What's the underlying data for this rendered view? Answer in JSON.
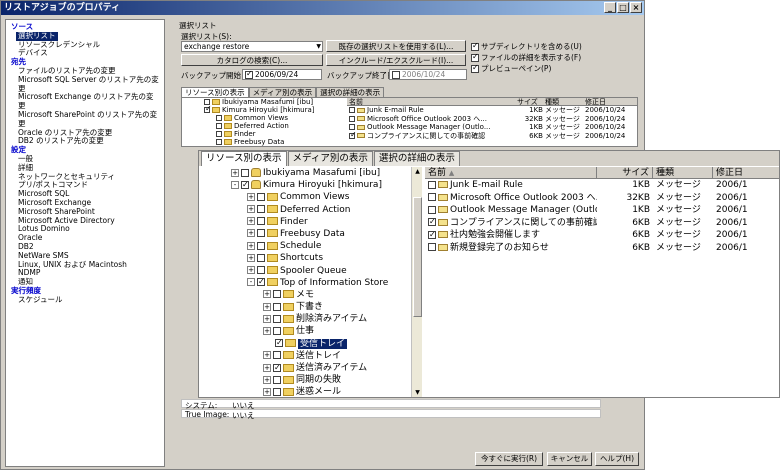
{
  "window": {
    "title": "リストアジョブのプロパティ",
    "controls": [
      "_",
      "□",
      "×"
    ]
  },
  "nav": [
    {
      "type": "sec",
      "label": "ソース"
    },
    {
      "type": "sel",
      "label": "選択リスト"
    },
    {
      "type": "it",
      "label": "リソースクレデンシャル"
    },
    {
      "type": "it",
      "label": "デバイス"
    },
    {
      "type": "sec",
      "label": "宛先"
    },
    {
      "type": "it",
      "label": "ファイルのリストア先の変更"
    },
    {
      "type": "it",
      "label": "Microsoft SQL Server のリストア先の変更"
    },
    {
      "type": "it",
      "label": "Microsoft Exchange のリストア先の変更"
    },
    {
      "type": "it",
      "label": "Microsoft SharePoint のリストア先の変更"
    },
    {
      "type": "it",
      "label": "Oracle のリストア先の変更"
    },
    {
      "type": "it",
      "label": "DB2 のリストア先の変更"
    },
    {
      "type": "sec",
      "label": "設定"
    },
    {
      "type": "it",
      "label": "一般"
    },
    {
      "type": "it",
      "label": "詳細"
    },
    {
      "type": "it",
      "label": "ネットワークとセキュリティ"
    },
    {
      "type": "it",
      "label": "プリ/ポストコマンド"
    },
    {
      "type": "it",
      "label": "Microsoft SQL"
    },
    {
      "type": "it",
      "label": "Microsoft Exchange"
    },
    {
      "type": "it",
      "label": "Microsoft SharePoint"
    },
    {
      "type": "it",
      "label": "Microsoft Active Directory"
    },
    {
      "type": "it",
      "label": "Lotus Domino"
    },
    {
      "type": "it",
      "label": "Oracle"
    },
    {
      "type": "it",
      "label": "DB2"
    },
    {
      "type": "it",
      "label": "NetWare SMS"
    },
    {
      "type": "it",
      "label": "Linux, UNIX および Macintosh"
    },
    {
      "type": "it",
      "label": "NDMP"
    },
    {
      "type": "it",
      "label": "通知"
    },
    {
      "type": "sec",
      "label": "実行頻度"
    },
    {
      "type": "it",
      "label": "スケジュール"
    }
  ],
  "form": {
    "group_label": "選択リスト",
    "list_label": "選択リスト(S):",
    "list_value": "exchange restore",
    "use_existing_btn": "既存の選択リストを使用する(L)...",
    "catalog_btn": "カタログの検索(C)...",
    "include_btn": "インクルード/エクスクルード(I)...",
    "backup_start_label": "バックアップ開始日(B):",
    "backup_start_value": "2006/09/24",
    "backup_end_label": "バックアップ終了日(E):",
    "backup_end_value": "2006/10/24",
    "chk_subdir": "サブディレクトリを含める(U)",
    "chk_fileinfo": "ファイルの詳細を表示する(F)",
    "chk_preview": "プレビューペイン(P)"
  },
  "small_tabs": [
    "リソース別の表示",
    "メディア別の表示",
    "選択の詳細の表示"
  ],
  "small_list": {
    "tree": [
      "Ibukiyama Masafumi [ibu]",
      "Kimura Hiroyuki [hkimura]",
      "Common Views",
      "Deferred Action",
      "Finder",
      "Freebusy Data"
    ],
    "headers": [
      "名前",
      "サイズ",
      "種類",
      "修正日"
    ],
    "rows": [
      [
        "Junk E-mail Rule",
        "1KB",
        "メッセージ",
        "2006/10/24"
      ],
      [
        "Microsoft Office Outlook 2003 へ...",
        "32KB",
        "メッセージ",
        "2006/10/24"
      ],
      [
        "Outlook Message Manager (Outlo...",
        "1KB",
        "メッセージ",
        "2006/10/24"
      ],
      [
        "コンプライアンスに関しての事前確認",
        "6KB",
        "メッセージ",
        "2006/10/24"
      ]
    ]
  },
  "zoom": {
    "tabs": [
      "リソース別の表示",
      "メディア別の表示",
      "選択の詳細の表示"
    ],
    "tree": [
      {
        "label": "Ibukiyama Masafumi [ibu]",
        "indent": 30,
        "exp": "+",
        "chk": false,
        "icon": "person"
      },
      {
        "label": "Kimura Hiroyuki [hkimura]",
        "indent": 30,
        "exp": "-",
        "chk": true,
        "icon": "person"
      },
      {
        "label": "Common Views",
        "indent": 46,
        "exp": "+",
        "chk": false,
        "icon": "folder"
      },
      {
        "label": "Deferred Action",
        "indent": 46,
        "exp": "+",
        "chk": false,
        "icon": "folder"
      },
      {
        "label": "Finder",
        "indent": 46,
        "exp": "+",
        "chk": false,
        "icon": "folder"
      },
      {
        "label": "Freebusy Data",
        "indent": 46,
        "exp": "+",
        "chk": false,
        "icon": "folder"
      },
      {
        "label": "Schedule",
        "indent": 46,
        "exp": "+",
        "chk": false,
        "icon": "folder"
      },
      {
        "label": "Shortcuts",
        "indent": 46,
        "exp": "+",
        "chk": false,
        "icon": "folder"
      },
      {
        "label": "Spooler Queue",
        "indent": 46,
        "exp": "+",
        "chk": false,
        "icon": "folder"
      },
      {
        "label": "Top of Information Store",
        "indent": 46,
        "exp": "-",
        "chk": true,
        "icon": "folder"
      },
      {
        "label": "メモ",
        "indent": 62,
        "exp": "+",
        "chk": false,
        "icon": "folder"
      },
      {
        "label": "下書き",
        "indent": 62,
        "exp": "+",
        "chk": false,
        "icon": "folder"
      },
      {
        "label": "削除済みアイテム",
        "indent": 62,
        "exp": "+",
        "chk": false,
        "icon": "folder"
      },
      {
        "label": "仕事",
        "indent": 62,
        "exp": "+",
        "chk": false,
        "icon": "folder"
      },
      {
        "label": "受信トレイ",
        "indent": 62,
        "exp": "",
        "chk": true,
        "icon": "folder",
        "selected": true
      },
      {
        "label": "送信トレイ",
        "indent": 62,
        "exp": "+",
        "chk": false,
        "icon": "folder"
      },
      {
        "label": "送信済みアイテム",
        "indent": 62,
        "exp": "+",
        "chk": true,
        "icon": "folder"
      },
      {
        "label": "同期の失敗",
        "indent": 62,
        "exp": "+",
        "chk": false,
        "icon": "folder"
      },
      {
        "label": "迷惑メール",
        "indent": 62,
        "exp": "+",
        "chk": false,
        "icon": "folder"
      }
    ],
    "headers": [
      "名前",
      "サイズ",
      "種類",
      "修正日"
    ],
    "rows": [
      {
        "name": "Junk E-mail Rule",
        "size": "1KB",
        "type": "メッセージ",
        "date": "2006/1",
        "chk": false
      },
      {
        "name": "Microsoft Office Outlook 2003 へ...",
        "size": "32KB",
        "type": "メッセージ",
        "date": "2006/1",
        "chk": false
      },
      {
        "name": "Outlook Message Manager (Outlo...",
        "size": "1KB",
        "type": "メッセージ",
        "date": "2006/1",
        "chk": false
      },
      {
        "name": "コンプライアンスに関しての事前確認",
        "size": "6KB",
        "type": "メッセージ",
        "date": "2006/1",
        "chk": true
      },
      {
        "name": "社内勉強会開催します",
        "size": "6KB",
        "type": "メッセージ",
        "date": "2006/1",
        "chk": true
      },
      {
        "name": "新規登録完了のお知らせ",
        "size": "6KB",
        "type": "メッセージ",
        "date": "2006/1",
        "chk": false
      }
    ]
  },
  "details": {
    "system_label": "システム:",
    "system_value": "いいえ",
    "trueimage_label": "True Image:",
    "trueimage_value": "いいえ"
  },
  "buttons": {
    "run": "今すぐに実行(R)",
    "cancel": "キャンセル",
    "help": "ヘルプ(H)"
  }
}
